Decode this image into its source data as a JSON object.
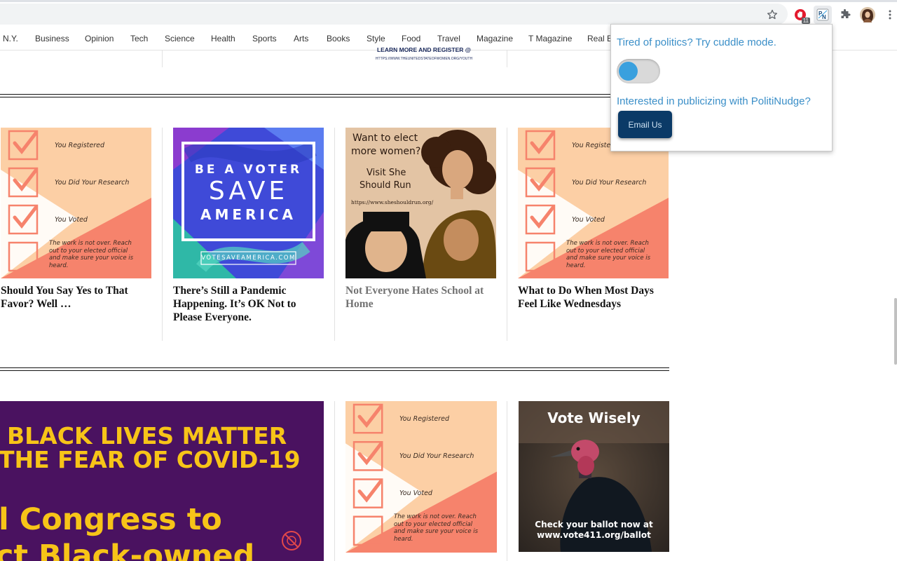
{
  "browser": {
    "star_icon": "star-outline",
    "extensions": [
      {
        "name": "adblock-icon",
        "badge": "11"
      },
      {
        "name": "politinudge-icon"
      },
      {
        "name": "puzzle-icon"
      },
      {
        "name": "profile-avatar"
      }
    ]
  },
  "nav": {
    "items": [
      "N.Y.",
      "Business",
      "Opinion",
      "Tech",
      "Science",
      "Health",
      "Sports",
      "Arts",
      "Books",
      "Style",
      "Food",
      "Travel",
      "Magazine",
      "T Magazine",
      "Real Estate"
    ]
  },
  "top_ad": {
    "line1": "LEARN MORE AND REGISTER @",
    "line2": "HTTPS://WWW.THEUNITEDSTATEOFWOMEN.ORG/YOUTH"
  },
  "row1": [
    {
      "title": "Should You Say Yes to That Favor? Well …",
      "visited": false,
      "image": {
        "type": "checklist",
        "items": [
          "You Registered",
          "You Did Your Research",
          "You Voted"
        ],
        "note": "The work is not over. Reach out to your elected official and make sure your voice is heard."
      }
    },
    {
      "title": "There’s Still a Pandemic Happening. It’s OK Not to Please Everyone.",
      "visited": false,
      "image": {
        "type": "voter",
        "line1": "BE A VOTER",
        "line2": "SAVE",
        "line3": "AMERICA",
        "url": "VOTESAVEAMERICA.COM"
      }
    },
    {
      "title": "Not Everyone Hates School at Home",
      "visited": true,
      "image": {
        "type": "women",
        "line1": "Want to elect",
        "line2": "more women?",
        "line3": "Visit She",
        "line4": "Should Run",
        "url": "https://www.sheshouldrun.org/"
      }
    },
    {
      "title": "What to Do When Most Days Feel Like Wednesdays",
      "visited": false,
      "image": {
        "type": "checklist",
        "items": [
          "You Registered",
          "You Did Your Research",
          "You Voted"
        ],
        "note": "The work is not over. Reach out to your elected official and make sure your voice is heard."
      }
    }
  ],
  "row2": {
    "banner": {
      "line1": "BLACK LIVES MATTER",
      "line2": "THE FEAR OF COVID-19",
      "line3": "l Congress to",
      "line4": "ct Black-owned"
    },
    "checklist": {
      "items": [
        "You Registered",
        "You Did Your Research",
        "You Voted"
      ],
      "note": "The work is not over. Reach out to your elected official and make sure your voice is heard."
    },
    "turkey": {
      "title": "Vote Wisely",
      "line1": "Check your ballot now at",
      "line2": "www.vote411.org/ballot"
    }
  },
  "popup": {
    "text1": "Tired of politics? Try cuddle mode.",
    "toggle_on": false,
    "text2": "Interested in publicizing with PolitiNudge?",
    "button": "Email Us"
  },
  "colors": {
    "popup_text": "#3b8fc8",
    "button_bg": "#0b3a67",
    "toggle_knob": "#3aa0de",
    "checklist_peach": "#fccfa5",
    "checklist_salmon": "#f6836c",
    "banner_purple": "#4a1260",
    "banner_yellow": "#f7c418"
  }
}
